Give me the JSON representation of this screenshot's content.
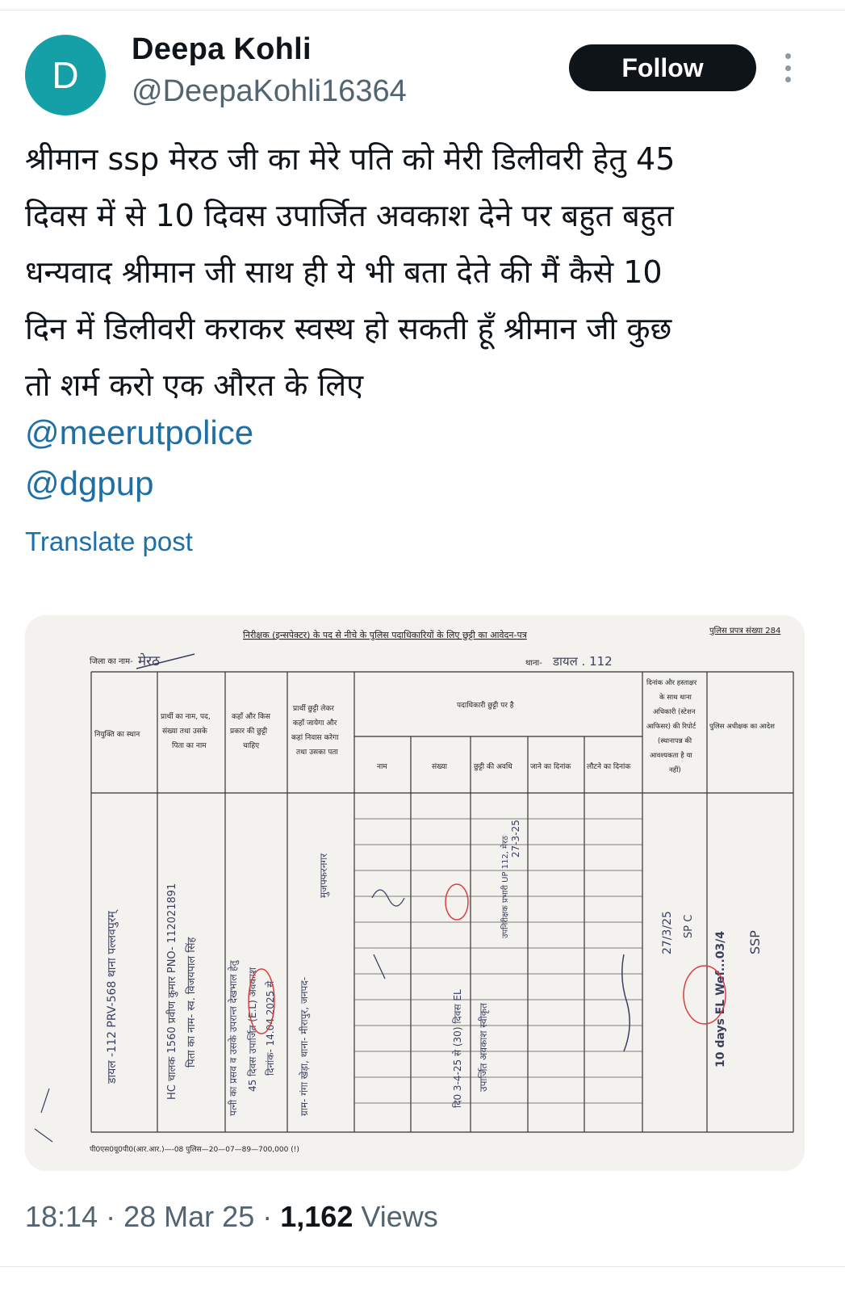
{
  "author": {
    "avatar_letter": "D",
    "name": "Deepa Kohli",
    "handle": "@DeepaKohli16364",
    "avatar_color": "#15a0a8"
  },
  "actions": {
    "follow_label": "Follow",
    "more_icon": "more-vertical-icon"
  },
  "post": {
    "lines": [
      "श्रीमान ssp मेरठ जी का मेरे पति को मेरी डिलीवरी हेतु 45",
      "दिवस में से 10 दिवस उपार्जित अवकाश देने पर बहुत बहुत",
      "धन्यवाद श्रीमान जी साथ ही ये भी बता देते की मैं कैसे 10",
      "दिन में डिलीवरी कराकर स्वस्थ हो सकती हूँ श्रीमान जी कुछ",
      "तो शर्म करो एक औरत के लिए"
    ],
    "mentions": [
      "@meerutpolice",
      "@dgpup"
    ],
    "translate_label": "Translate post"
  },
  "document": {
    "title": "निरीक्षक (इन्सपेक्टर) के पद से नीचे के पुलिस पदाधिकारियों के लिए छुट्टी का आवेदन-पत्र",
    "form_no": "पुलिस प्रपत्र संख्या 284",
    "district_label": "जिला का नाम-",
    "district_value": "मेरठ",
    "station_label": "थाना-",
    "station_value": "डायल . 112",
    "headers": {
      "col1": [
        "नियुक्ति का स्थान"
      ],
      "col2": [
        "प्रार्थी का नाम, पद,",
        "संख्या तथा उसके",
        "पिता का नाम"
      ],
      "col3": [
        "कहाँ और किस",
        "प्रकार की छुट्टी",
        "चाहिए"
      ],
      "col4": [
        "प्रार्थी छुट्टी लेकर",
        "कहाँ जायेगा और",
        "कहां निवास करेगा",
        "तथा उसका पता"
      ],
      "group": "पदाधिकारी छुट्टी पर है",
      "sub": [
        "नाम",
        "संख्या",
        "छुट्टी की अवधि",
        "जाने का दिनांक",
        "लौटने का दिनांक"
      ],
      "col10": [
        "दिनांक और हस्ताक्षर",
        "के साथ थाना",
        "अधिकारी (स्टेशन",
        "आफिसर) की रिपोर्ट",
        "(स्थानापन्न की",
        "आवश्यकता है या",
        "नहीं)"
      ],
      "col11": [
        "पुलिस अधीक्षक का आदेश"
      ]
    },
    "handwritten": {
      "posting": "डायल -112 PRV-568 थाना पल्लवपुरम्",
      "applicant_1": "HC चालक 1560 प्रवीण कुमार PNO- 112021891",
      "applicant_2": "पिता का नाम- स्व. विजयपाल सिंह",
      "leave_1": "पत्नी का प्रसव व उसके उपरान्त देखभाल हेतु",
      "leave_2": "45 दिवस उपार्जित (E.L) अवकाश",
      "leave_3": "दिनांक- 14.04.2025 से",
      "address_1": "ग्राम- गंगा खेड़ा, थाना- मीरापुर, जनपद-",
      "address_2": "मुजफ्फरनगर",
      "period": "दि0 3-4-25 से (30) दिवस EL",
      "approval": "उपार्जित अवकाश स्वीकृत",
      "stamp": "उपनिरीक्षक प्रभारी UP 112, मेरठ",
      "date_sign": "27-3-25",
      "ssp_date": "27/3/25",
      "ssp_code": "SP C",
      "ssp_order": "10 days EL Wef...03/4",
      "ssp_sign": "SSP"
    },
    "footer": "पी0एस0यू0पी0(आर.आर.)—-08 पुलिस—20—07—89—700,000 (!)"
  },
  "meta": {
    "time": "18:14",
    "date": "28 Mar 25",
    "views_count": "1,162",
    "views_label": "Views",
    "sep": "·"
  }
}
